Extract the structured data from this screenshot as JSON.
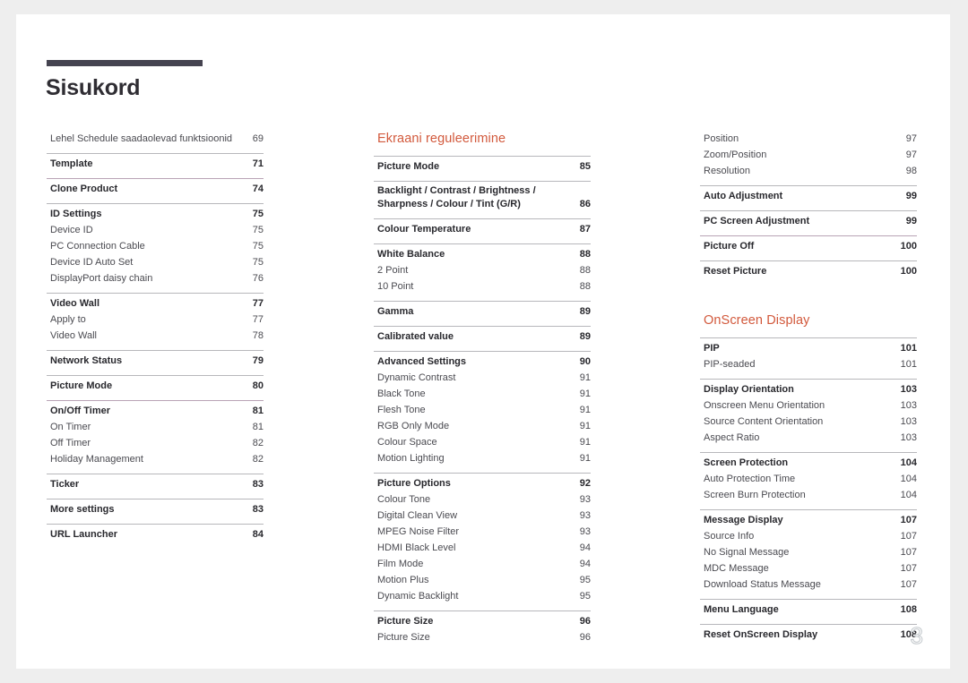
{
  "document": {
    "title": "Sisukord",
    "folio": "3"
  },
  "columns": {
    "left": {
      "groups": [
        {
          "rule": "none",
          "rows": [
            {
              "label": "Lehel Schedule saadaolevad funktsioonid",
              "page": "69",
              "level": "sub"
            }
          ]
        },
        {
          "rule": "gray",
          "rows": [
            {
              "label": "Template",
              "page": "71",
              "level": "main"
            }
          ]
        },
        {
          "rule": "tinted",
          "rows": [
            {
              "label": "Clone Product",
              "page": "74",
              "level": "main"
            }
          ]
        },
        {
          "rule": "gray",
          "rows": [
            {
              "label": "ID Settings",
              "page": "75",
              "level": "main"
            },
            {
              "label": "Device ID",
              "page": "75",
              "level": "sub"
            },
            {
              "label": "PC Connection Cable",
              "page": "75",
              "level": "sub"
            },
            {
              "label": "Device ID Auto Set",
              "page": "75",
              "level": "sub"
            },
            {
              "label": "DisplayPort daisy chain",
              "page": "76",
              "level": "sub"
            }
          ]
        },
        {
          "rule": "gray",
          "rows": [
            {
              "label": "Video Wall",
              "page": "77",
              "level": "main"
            },
            {
              "label": "Apply to",
              "page": "77",
              "level": "sub"
            },
            {
              "label": "Video Wall",
              "page": "78",
              "level": "sub"
            }
          ]
        },
        {
          "rule": "gray",
          "rows": [
            {
              "label": "Network Status",
              "page": "79",
              "level": "main"
            }
          ]
        },
        {
          "rule": "gray",
          "rows": [
            {
              "label": "Picture Mode",
              "page": "80",
              "level": "main"
            }
          ]
        },
        {
          "rule": "tinted",
          "rows": [
            {
              "label": "On/Off Timer",
              "page": "81",
              "level": "main"
            },
            {
              "label": "On Timer",
              "page": "81",
              "level": "sub"
            },
            {
              "label": "Off Timer",
              "page": "82",
              "level": "sub"
            },
            {
              "label": "Holiday Management",
              "page": "82",
              "level": "sub"
            }
          ]
        },
        {
          "rule": "gray",
          "rows": [
            {
              "label": "Ticker",
              "page": "83",
              "level": "main"
            }
          ]
        },
        {
          "rule": "gray",
          "rows": [
            {
              "label": "More settings",
              "page": "83",
              "level": "main"
            }
          ]
        },
        {
          "rule": "gray",
          "rows": [
            {
              "label": "URL Launcher",
              "page": "84",
              "level": "main"
            }
          ]
        }
      ]
    },
    "middle": {
      "heading": "Ekraani reguleerimine",
      "groups": [
        {
          "rule": "gray",
          "rows": [
            {
              "label": "Picture Mode",
              "page": "85",
              "level": "main"
            }
          ]
        },
        {
          "rule": "gray",
          "rows": [
            {
              "label": "Backlight / Contrast / Brightness / Sharpness / Colour / Tint (G/R)",
              "page": "86",
              "level": "main",
              "multiline": true
            }
          ]
        },
        {
          "rule": "gray",
          "rows": [
            {
              "label": "Colour Temperature",
              "page": "87",
              "level": "main"
            }
          ]
        },
        {
          "rule": "gray",
          "rows": [
            {
              "label": "White Balance",
              "page": "88",
              "level": "main"
            },
            {
              "label": "2 Point",
              "page": "88",
              "level": "sub"
            },
            {
              "label": "10 Point",
              "page": "88",
              "level": "sub"
            }
          ]
        },
        {
          "rule": "gray",
          "rows": [
            {
              "label": "Gamma",
              "page": "89",
              "level": "main"
            }
          ]
        },
        {
          "rule": "gray",
          "rows": [
            {
              "label": "Calibrated value",
              "page": "89",
              "level": "main"
            }
          ]
        },
        {
          "rule": "gray",
          "rows": [
            {
              "label": "Advanced Settings",
              "page": "90",
              "level": "main"
            },
            {
              "label": "Dynamic Contrast",
              "page": "91",
              "level": "sub"
            },
            {
              "label": "Black Tone",
              "page": "91",
              "level": "sub"
            },
            {
              "label": "Flesh Tone",
              "page": "91",
              "level": "sub"
            },
            {
              "label": "RGB Only Mode",
              "page": "91",
              "level": "sub"
            },
            {
              "label": "Colour Space",
              "page": "91",
              "level": "sub"
            },
            {
              "label": "Motion Lighting",
              "page": "91",
              "level": "sub"
            }
          ]
        },
        {
          "rule": "gray",
          "rows": [
            {
              "label": "Picture Options",
              "page": "92",
              "level": "main"
            },
            {
              "label": "Colour Tone",
              "page": "93",
              "level": "sub"
            },
            {
              "label": "Digital Clean View",
              "page": "93",
              "level": "sub"
            },
            {
              "label": "MPEG Noise Filter",
              "page": "93",
              "level": "sub"
            },
            {
              "label": "HDMI Black Level",
              "page": "94",
              "level": "sub"
            },
            {
              "label": "Film Mode",
              "page": "94",
              "level": "sub"
            },
            {
              "label": "Motion Plus",
              "page": "95",
              "level": "sub"
            },
            {
              "label": "Dynamic Backlight",
              "page": "95",
              "level": "sub"
            }
          ]
        },
        {
          "rule": "gray",
          "rows": [
            {
              "label": "Picture Size",
              "page": "96",
              "level": "main"
            },
            {
              "label": "Picture Size",
              "page": "96",
              "level": "sub"
            }
          ]
        }
      ]
    },
    "right": {
      "groups_top": [
        {
          "rule": "none",
          "rows": [
            {
              "label": "Position",
              "page": "97",
              "level": "sub"
            },
            {
              "label": "Zoom/Position",
              "page": "97",
              "level": "sub"
            },
            {
              "label": "Resolution",
              "page": "98",
              "level": "sub"
            }
          ]
        },
        {
          "rule": "gray",
          "rows": [
            {
              "label": "Auto Adjustment",
              "page": "99",
              "level": "main"
            }
          ]
        },
        {
          "rule": "gray",
          "rows": [
            {
              "label": "PC Screen Adjustment",
              "page": "99",
              "level": "main"
            }
          ]
        },
        {
          "rule": "tinted",
          "rows": [
            {
              "label": "Picture Off",
              "page": "100",
              "level": "main"
            }
          ]
        },
        {
          "rule": "gray",
          "rows": [
            {
              "label": "Reset Picture",
              "page": "100",
              "level": "main"
            }
          ]
        }
      ],
      "heading": "OnScreen Display",
      "groups_bottom": [
        {
          "rule": "gray",
          "rows": [
            {
              "label": "PIP",
              "page": "101",
              "level": "main"
            },
            {
              "label": "PIP-seaded",
              "page": "101",
              "level": "sub"
            }
          ]
        },
        {
          "rule": "gray",
          "rows": [
            {
              "label": "Display Orientation",
              "page": "103",
              "level": "main"
            },
            {
              "label": "Onscreen Menu Orientation",
              "page": "103",
              "level": "sub"
            },
            {
              "label": "Source Content Orientation",
              "page": "103",
              "level": "sub"
            },
            {
              "label": "Aspect Ratio",
              "page": "103",
              "level": "sub"
            }
          ]
        },
        {
          "rule": "gray",
          "rows": [
            {
              "label": "Screen Protection",
              "page": "104",
              "level": "main"
            },
            {
              "label": "Auto Protection Time",
              "page": "104",
              "level": "sub"
            },
            {
              "label": "Screen Burn Protection",
              "page": "104",
              "level": "sub"
            }
          ]
        },
        {
          "rule": "gray",
          "rows": [
            {
              "label": "Message Display",
              "page": "107",
              "level": "main"
            },
            {
              "label": "Source Info",
              "page": "107",
              "level": "sub"
            },
            {
              "label": "No Signal Message",
              "page": "107",
              "level": "sub"
            },
            {
              "label": "MDC Message",
              "page": "107",
              "level": "sub"
            },
            {
              "label": "Download Status Message",
              "page": "107",
              "level": "sub"
            }
          ]
        },
        {
          "rule": "gray",
          "rows": [
            {
              "label": "Menu Language",
              "page": "108",
              "level": "main"
            }
          ]
        },
        {
          "rule": "gray",
          "rows": [
            {
              "label": "Reset OnScreen Display",
              "page": "108",
              "level": "main"
            }
          ]
        }
      ]
    }
  },
  "colors": {
    "heading_accent": "#d2593c",
    "title_bar": "#454350",
    "rule_gray": "#b7b7bb",
    "rule_tinted": "#b9a3b5",
    "page_bg": "#ffffff",
    "canvas_bg": "#eeeeee"
  }
}
